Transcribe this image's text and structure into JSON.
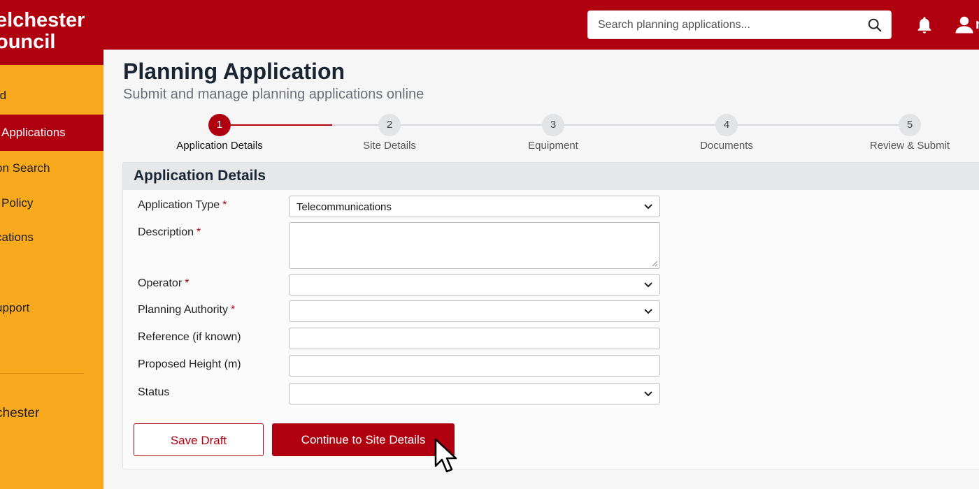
{
  "header": {
    "brand_line1": "elchester",
    "brand_line2": "ouncil",
    "search_placeholder": "Search planning applications...",
    "search_icon": "search-icon",
    "notifications_icon": "bell-icon",
    "account_icon": "user-icon",
    "account_cut_text": "n",
    "brand_color": "#b00010"
  },
  "sidebar": {
    "accent_color": "#f9a91e",
    "items": [
      {
        "label": "rd",
        "active": false
      },
      {
        "label": "Applications",
        "active": true
      },
      {
        "label": "on Search",
        "active": false
      },
      {
        "label": "Policy",
        "active": false
      },
      {
        "label": "cations",
        "active": false
      },
      {
        "label": "upport",
        "active": false
      },
      {
        "label": "chester",
        "active": false
      }
    ]
  },
  "page": {
    "title": "Planning Application",
    "subtitle": "Submit and manage planning applications online"
  },
  "stepper": {
    "current_step": 1,
    "steps": [
      {
        "number": "1",
        "label": "Application Details"
      },
      {
        "number": "2",
        "label": "Site Details"
      },
      {
        "number": "3",
        "label": "Equipment"
      },
      {
        "number": "4",
        "label": "Documents"
      },
      {
        "number": "5",
        "label": "Review & Submit"
      }
    ]
  },
  "form": {
    "section_title": "Application Details",
    "required_mark": "*",
    "fields": {
      "application_type": {
        "label": "Application Type",
        "value": "Telecommunications",
        "required": true
      },
      "description": {
        "label": "Description",
        "value": "",
        "required": true
      },
      "operator": {
        "label": "Operator",
        "value": "",
        "required": true
      },
      "planning_authority": {
        "label": "Planning Authority",
        "value": "",
        "required": true
      },
      "reference": {
        "label": "Reference (if known)",
        "value": "",
        "required": false
      },
      "proposed_height": {
        "label": "Proposed Height (m)",
        "value": "",
        "required": false
      },
      "status": {
        "label": "Status",
        "value": "",
        "required": false
      }
    },
    "save_draft_label": "Save Draft",
    "continue_label": "Continue to Site Details"
  }
}
